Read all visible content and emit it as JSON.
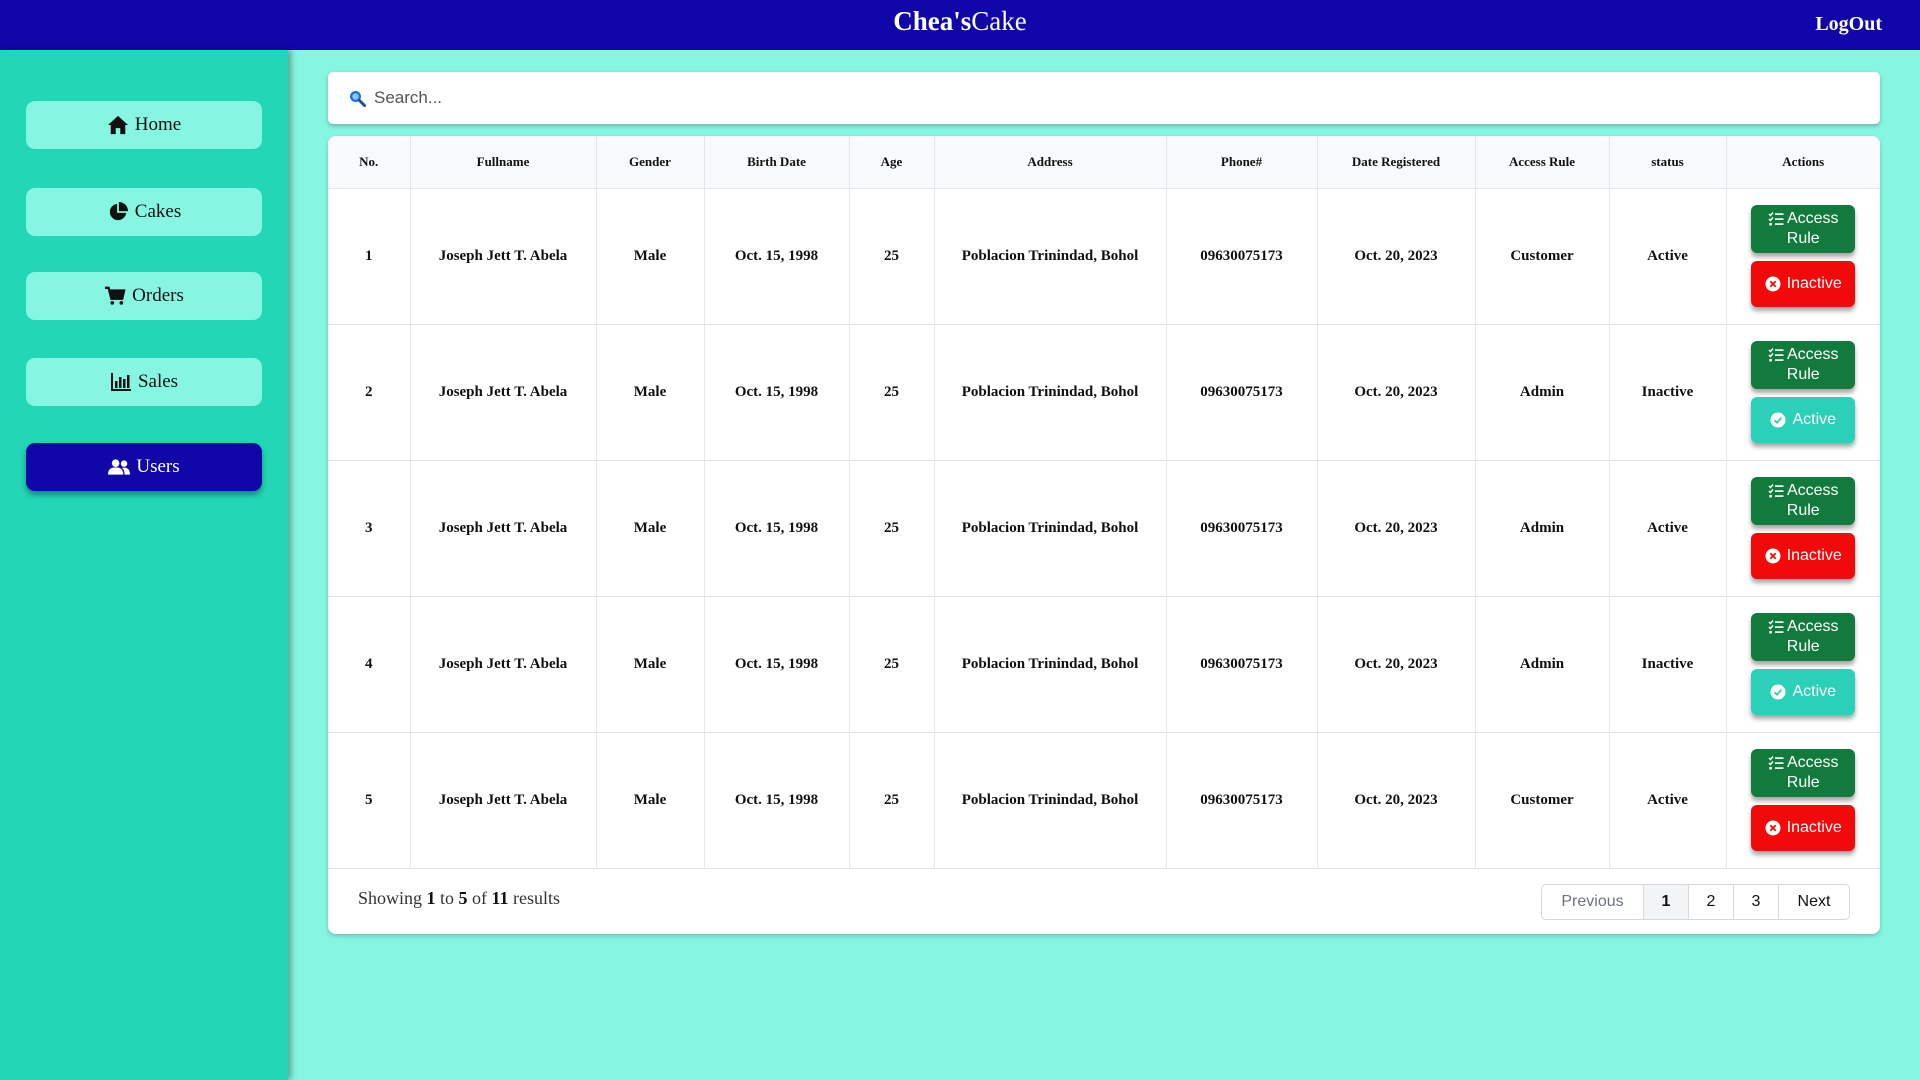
{
  "header": {
    "brand_bold": "Chea's",
    "brand_rest": "Cake",
    "logout": "LogOut"
  },
  "sidebar": {
    "items": [
      {
        "label": "Home",
        "icon": "home-icon"
      },
      {
        "label": "Cakes",
        "icon": "pie-chart-icon"
      },
      {
        "label": "Orders",
        "icon": "cart-icon"
      },
      {
        "label": "Sales",
        "icon": "bar-chart-icon"
      },
      {
        "label": "Users",
        "icon": "users-icon",
        "active": true
      }
    ]
  },
  "search": {
    "placeholder": "Search..."
  },
  "table": {
    "headers": [
      "No.",
      "Fullname",
      "Gender",
      "Birth Date",
      "Age",
      "Address",
      "Phone#",
      "Date Registered",
      "Access Rule",
      "status",
      "Actions"
    ],
    "rows": [
      {
        "no": "1",
        "name": "Joseph Jett T. Abela",
        "gender": "Male",
        "birth": "Oct. 15, 1998",
        "age": "25",
        "address": "Poblacion Trinindad, Bohol",
        "phone": "09630075173",
        "registered": "Oct. 20, 2023",
        "access": "Customer",
        "status": "Active",
        "toggle": "Inactive"
      },
      {
        "no": "2",
        "name": "Joseph Jett T. Abela",
        "gender": "Male",
        "birth": "Oct. 15, 1998",
        "age": "25",
        "address": "Poblacion Trinindad, Bohol",
        "phone": "09630075173",
        "registered": "Oct. 20, 2023",
        "access": "Admin",
        "status": "Inactive",
        "toggle": "Active"
      },
      {
        "no": "3",
        "name": "Joseph Jett T. Abela",
        "gender": "Male",
        "birth": "Oct. 15, 1998",
        "age": "25",
        "address": "Poblacion Trinindad, Bohol",
        "phone": "09630075173",
        "registered": "Oct. 20, 2023",
        "access": "Admin",
        "status": "Active",
        "toggle": "Inactive"
      },
      {
        "no": "4",
        "name": "Joseph Jett T. Abela",
        "gender": "Male",
        "birth": "Oct. 15, 1998",
        "age": "25",
        "address": "Poblacion Trinindad, Bohol",
        "phone": "09630075173",
        "registered": "Oct. 20, 2023",
        "access": "Admin",
        "status": "Inactive",
        "toggle": "Active"
      },
      {
        "no": "5",
        "name": "Joseph Jett T. Abela",
        "gender": "Male",
        "birth": "Oct. 15, 1998",
        "age": "25",
        "address": "Poblacion Trinindad, Bohol",
        "phone": "09630075173",
        "registered": "Oct. 20, 2023",
        "access": "Customer",
        "status": "Active",
        "toggle": "Inactive"
      }
    ],
    "access_btn_line1": "Access",
    "access_btn_line2": "Rule"
  },
  "footer": {
    "showing_prefix": "Showing",
    "from": "1",
    "to_word": "to",
    "to": "5",
    "of_word": "of",
    "total": "11",
    "results_word": "results",
    "prev": "Previous",
    "pages": [
      "1",
      "2",
      "3"
    ],
    "next": "Next"
  },
  "colors": {
    "navy": "#1106a8",
    "teal": "#22d6b6",
    "mint": "#86f5e1",
    "green": "#137a3e",
    "red": "#f20a0a"
  }
}
